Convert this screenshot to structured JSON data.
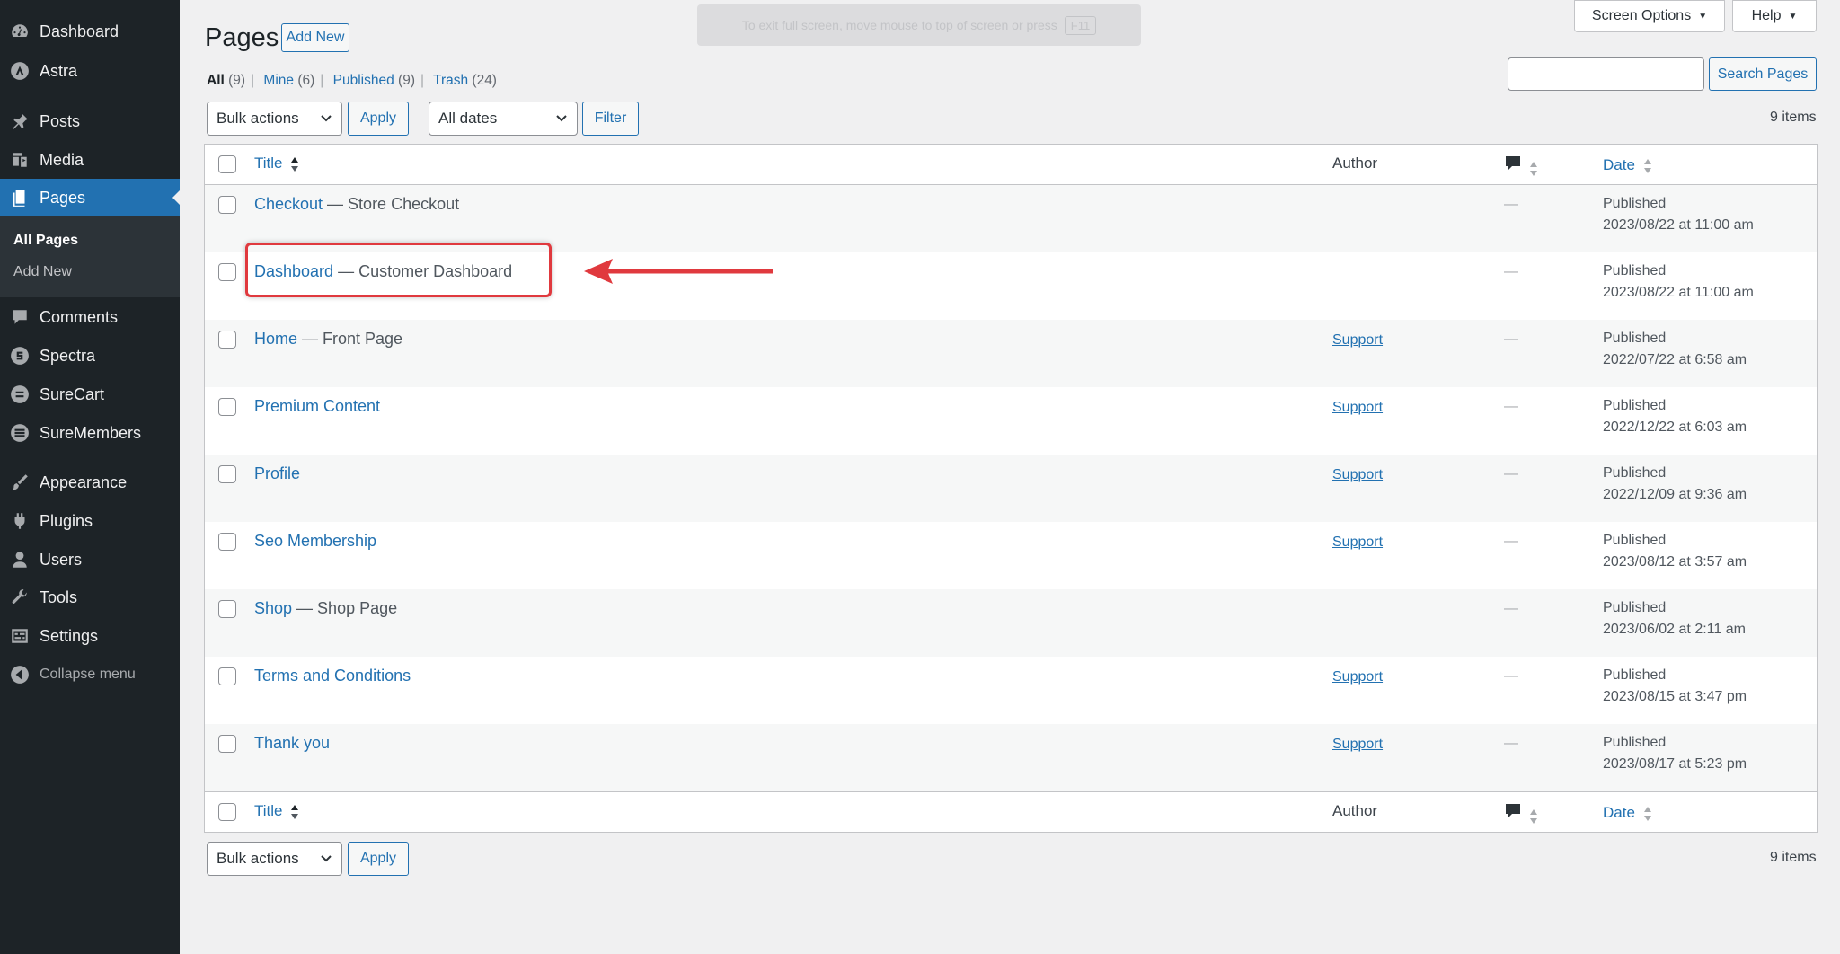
{
  "sidebar": {
    "items": [
      {
        "label": "Dashboard",
        "icon": "dashboard-icon"
      },
      {
        "label": "Astra",
        "icon": "astra-icon"
      },
      {
        "label": "Posts",
        "icon": "pushpin-icon"
      },
      {
        "label": "Media",
        "icon": "media-icon"
      },
      {
        "label": "Pages",
        "icon": "pages-icon"
      },
      {
        "label": "Comments",
        "icon": "comment-icon"
      },
      {
        "label": "Spectra",
        "icon": "spectra-icon"
      },
      {
        "label": "SureCart",
        "icon": "surecart-icon"
      },
      {
        "label": "SureMembers",
        "icon": "suremembers-icon"
      },
      {
        "label": "Appearance",
        "icon": "paintbrush-icon"
      },
      {
        "label": "Plugins",
        "icon": "plugin-icon"
      },
      {
        "label": "Users",
        "icon": "user-icon"
      },
      {
        "label": "Tools",
        "icon": "wrench-icon"
      },
      {
        "label": "Settings",
        "icon": "settings-icon"
      }
    ],
    "submenu": [
      {
        "label": "All Pages"
      },
      {
        "label": "Add New"
      }
    ],
    "collapse_label": "Collapse menu"
  },
  "header": {
    "title": "Pages",
    "add_new_label": "Add New",
    "screen_options_label": "Screen Options",
    "help_label": "Help",
    "fullscreen_notice": "To exit full screen, move mouse to top of screen or press",
    "fullscreen_key": "F11"
  },
  "filters": {
    "all_label": "All",
    "all_count": "(9)",
    "mine_label": "Mine",
    "mine_count": "(6)",
    "published_label": "Published",
    "published_count": "(9)",
    "trash_label": "Trash",
    "trash_count": "(24)",
    "bulk_actions": "Bulk actions",
    "apply_label": "Apply",
    "dates": "All dates",
    "filter_label": "Filter",
    "search_button": "Search Pages",
    "items_count": "9 items"
  },
  "table": {
    "columns": {
      "title": "Title",
      "author": "Author",
      "date": "Date"
    },
    "rows": [
      {
        "title": "Checkout",
        "state": " — Store Checkout",
        "author": "",
        "comments": "—",
        "status": "Published",
        "date": "2023/08/22 at 11:00 am"
      },
      {
        "title": "Dashboard",
        "state": " — Customer Dashboard",
        "author": "",
        "comments": "—",
        "status": "Published",
        "date": "2023/08/22 at 11:00 am"
      },
      {
        "title": "Home",
        "state": " — Front Page",
        "author": "Support",
        "comments": "—",
        "status": "Published",
        "date": "2022/07/22 at 6:58 am"
      },
      {
        "title": "Premium Content",
        "state": "",
        "author": "Support",
        "comments": "—",
        "status": "Published",
        "date": "2022/12/22 at 6:03 am"
      },
      {
        "title": "Profile",
        "state": "",
        "author": "Support",
        "comments": "—",
        "status": "Published",
        "date": "2022/12/09 at 9:36 am"
      },
      {
        "title": "Seo Membership",
        "state": "",
        "author": "Support",
        "comments": "—",
        "status": "Published",
        "date": "2023/08/12 at 3:57 am"
      },
      {
        "title": "Shop",
        "state": " — Shop Page",
        "author": "",
        "comments": "—",
        "status": "Published",
        "date": "2023/06/02 at 2:11 am"
      },
      {
        "title": "Terms and Conditions",
        "state": "",
        "author": "Support",
        "comments": "—",
        "status": "Published",
        "date": "2023/08/15 at 3:47 pm"
      },
      {
        "title": "Thank you",
        "state": "",
        "author": "Support",
        "comments": "—",
        "status": "Published",
        "date": "2023/08/17 at 5:23 pm"
      }
    ]
  },
  "colors": {
    "sidebar_bg": "#1d2327",
    "accent": "#2271b1",
    "highlight": "#e0393e"
  }
}
